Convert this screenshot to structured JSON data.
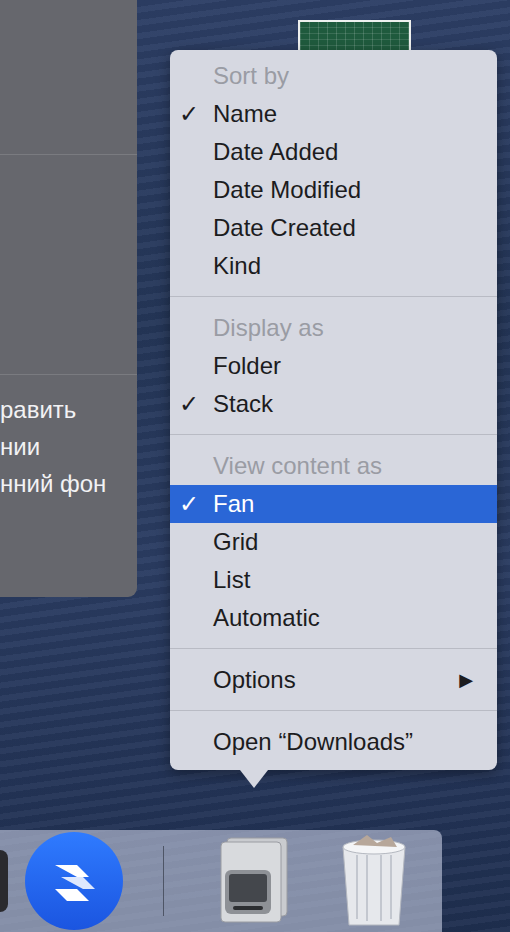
{
  "desktop_panel": {
    "lines": [
      "равить",
      "нии",
      "нний фон"
    ]
  },
  "menu": {
    "check_mark": "✓",
    "sections": [
      {
        "header": "Sort by",
        "items": [
          {
            "label": "Name",
            "checked": true,
            "selected": false
          },
          {
            "label": "Date Added",
            "checked": false,
            "selected": false
          },
          {
            "label": "Date Modified",
            "checked": false,
            "selected": false
          },
          {
            "label": "Date Created",
            "checked": false,
            "selected": false
          },
          {
            "label": "Kind",
            "checked": false,
            "selected": false
          }
        ]
      },
      {
        "header": "Display as",
        "items": [
          {
            "label": "Folder",
            "checked": false,
            "selected": false
          },
          {
            "label": "Stack",
            "checked": true,
            "selected": false
          }
        ]
      },
      {
        "header": "View content as",
        "items": [
          {
            "label": "Fan",
            "checked": true,
            "selected": true
          },
          {
            "label": "Grid",
            "checked": false,
            "selected": false
          },
          {
            "label": "List",
            "checked": false,
            "selected": false
          },
          {
            "label": "Automatic",
            "checked": false,
            "selected": false
          }
        ]
      },
      {
        "items": [
          {
            "label": "Options",
            "checked": false,
            "selected": false,
            "submenu_icon": "▶"
          }
        ]
      },
      {
        "items": [
          {
            "label": "Open “Downloads”",
            "checked": false,
            "selected": false
          }
        ]
      }
    ]
  }
}
